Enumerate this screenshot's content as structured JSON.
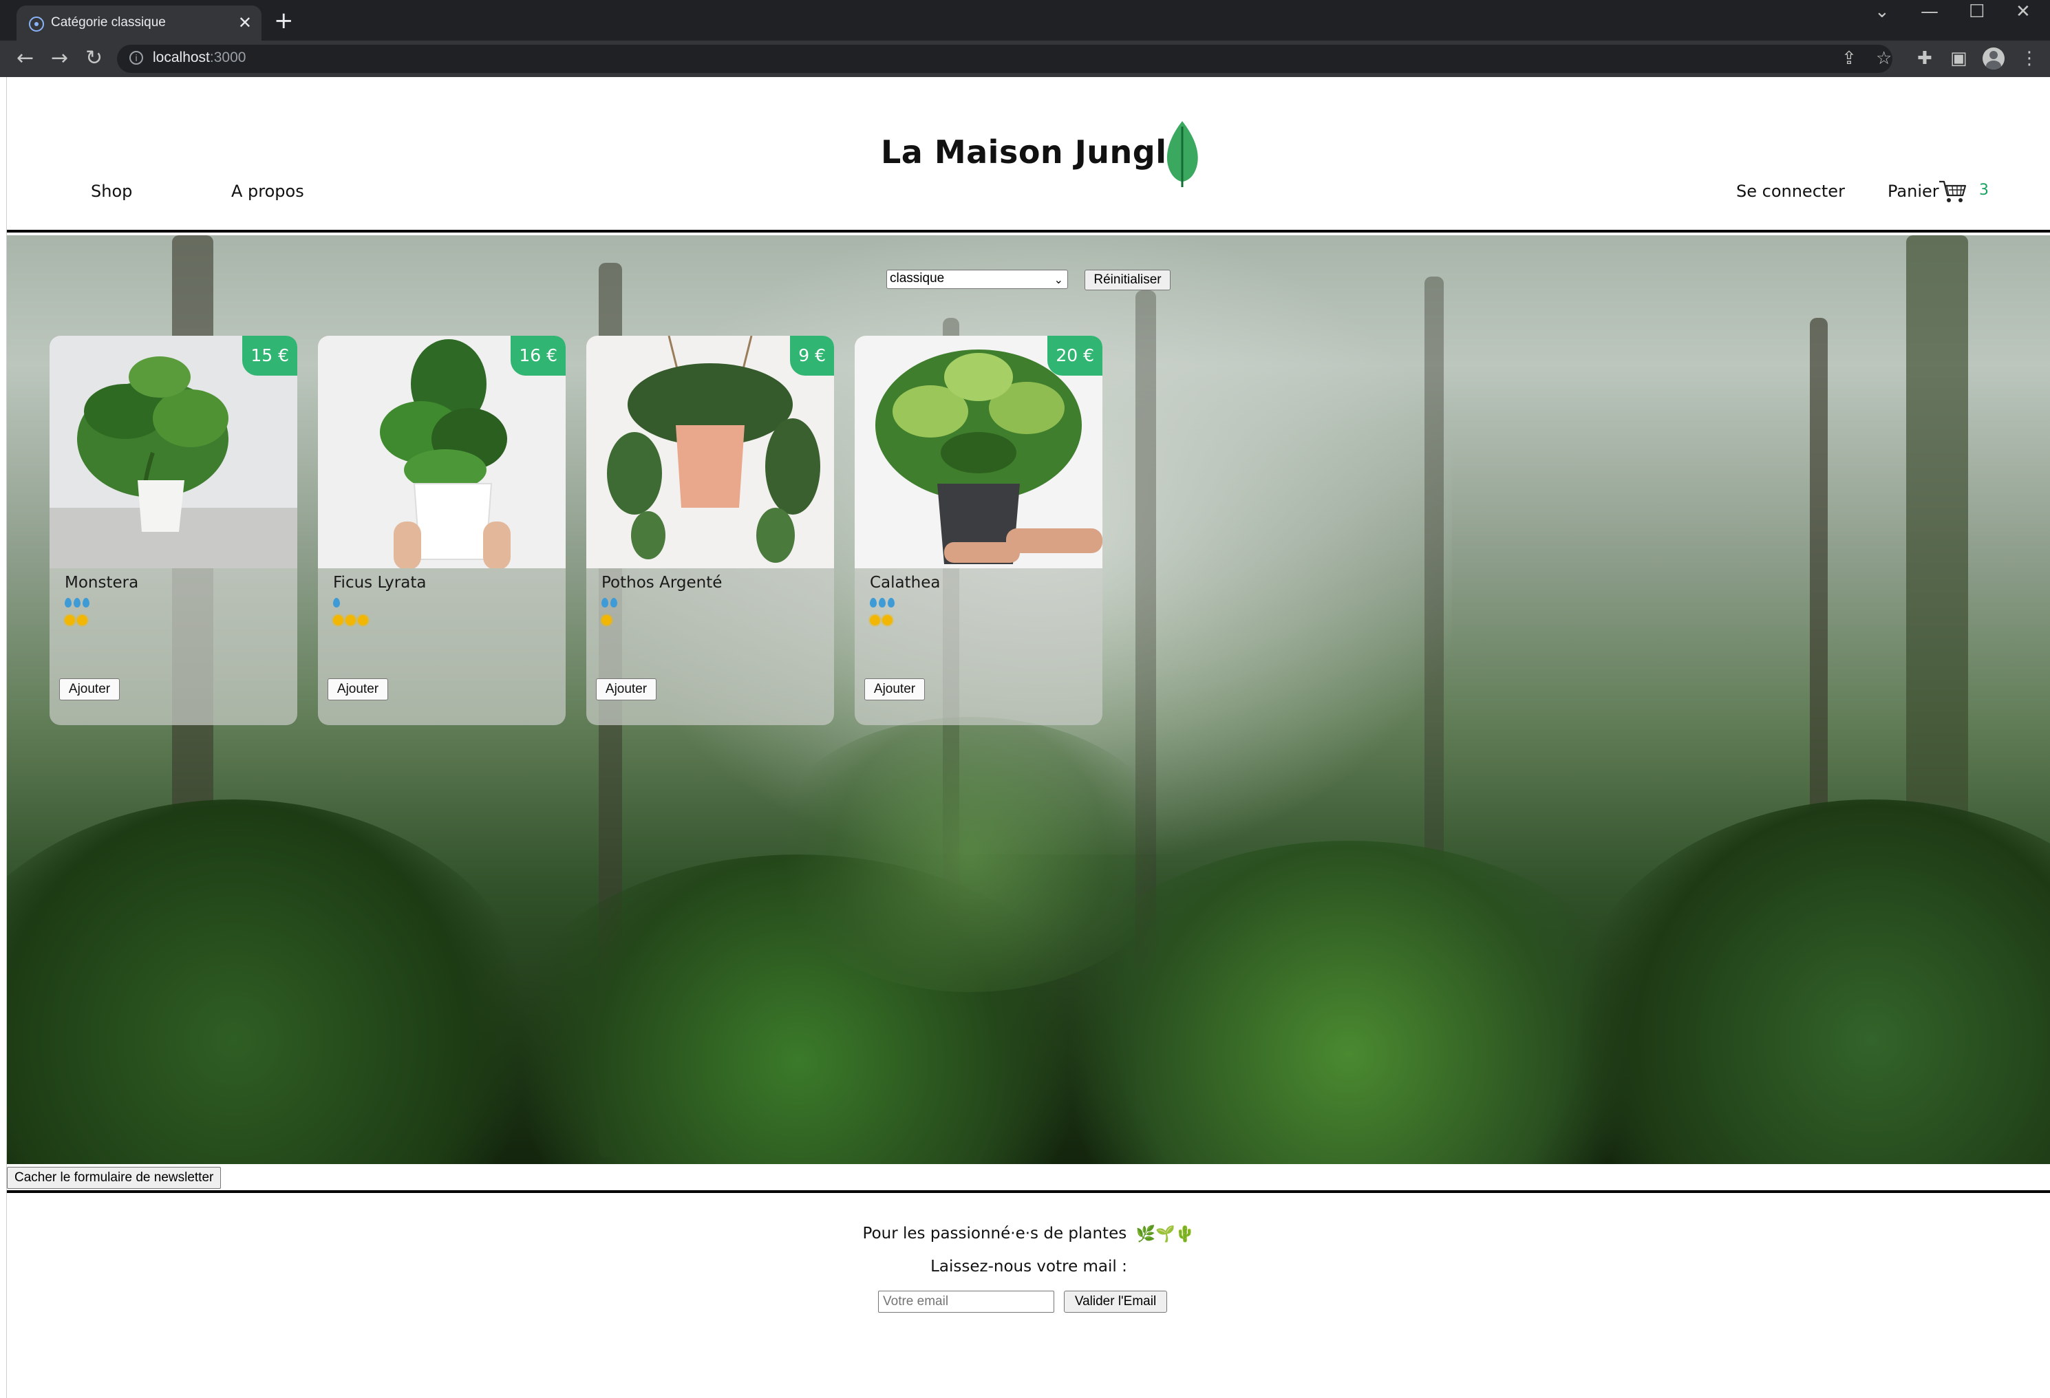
{
  "browser": {
    "tab_title": "Catégorie classique",
    "tab_close": "✕",
    "new_tab": "+",
    "url_host": "localhost",
    "url_port": ":3000",
    "back": "←",
    "forward": "→",
    "reload": "↻",
    "window_controls": {
      "chevron": "⌄",
      "minimize": "—",
      "maximize": "☐",
      "close": "✕"
    }
  },
  "header": {
    "brand": "La Maison Jungle",
    "nav": {
      "shop": "Shop",
      "about": "A propos"
    },
    "login": "Se connecter",
    "cart_label": "Panier",
    "cart_count": "3"
  },
  "filter": {
    "selected_category": "classique",
    "reset_label": "Réinitialiser"
  },
  "plants": [
    {
      "name": "Monstera",
      "price": "15 €",
      "water": 3,
      "light": 2,
      "add_label": "Ajouter"
    },
    {
      "name": "Ficus Lyrata",
      "price": "16 €",
      "water": 1,
      "light": 3,
      "add_label": "Ajouter"
    },
    {
      "name": "Pothos Argenté",
      "price": "9 €",
      "water": 2,
      "light": 1,
      "add_label": "Ajouter"
    },
    {
      "name": "Calathea",
      "price": "20 €",
      "water": 3,
      "light": 2,
      "add_label": "Ajouter"
    }
  ],
  "newsletter": {
    "toggle_label": "Cacher le formulaire de newsletter",
    "title": "Pour les passionné·e·s de plantes",
    "emojis": "🌿🌱🌵",
    "subtitle": "Laissez-nous votre mail :",
    "email_placeholder": "Votre email",
    "submit_label": "Valider l'Email"
  },
  "colors": {
    "accent_green": "#31b572",
    "cart_count": "#1aa260",
    "water": "#3f9bd6",
    "sun": "#f2b705"
  }
}
